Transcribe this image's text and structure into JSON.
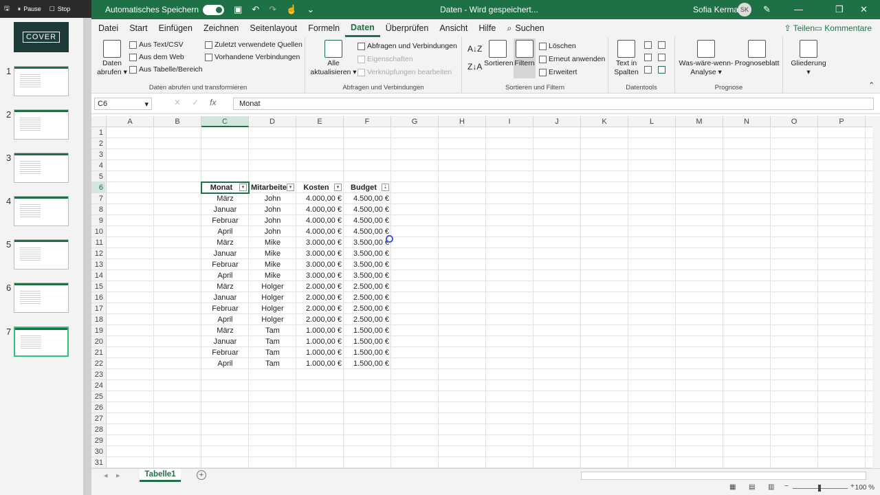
{
  "recorder": {
    "pause": "Pause",
    "stop": "Stop"
  },
  "slides": {
    "cover": "COVER",
    "numbers": [
      "1",
      "2",
      "3",
      "4",
      "5",
      "6",
      "7"
    ]
  },
  "title": {
    "autosave": "Automatisches Speichern",
    "document": "Daten  -  Wird gespeichert...",
    "user": "Sofia Kermas",
    "avatar": "SK"
  },
  "menu": {
    "items": [
      "Datei",
      "Start",
      "Einfügen",
      "Zeichnen",
      "Seitenlayout",
      "Formeln",
      "Daten",
      "Überprüfen",
      "Ansicht",
      "Hilfe"
    ],
    "active": "Daten",
    "search": "Suchen",
    "share": "Teilen",
    "comments": "Kommentare"
  },
  "ribbon": {
    "g1": {
      "big": "Daten abrufen",
      "small": [
        "Aus Text/CSV",
        "Aus dem Web",
        "Aus Tabelle/Bereich",
        "Zuletzt verwendete Quellen",
        "Vorhandene Verbindungen"
      ],
      "label": "Daten abrufen und transformieren"
    },
    "g2": {
      "big": "Alle aktualisieren",
      "small": [
        "Abfragen und Verbindungen",
        "Eigenschaften",
        "Verknüpfungen bearbeiten"
      ],
      "label": "Abfragen und Verbindungen"
    },
    "g3": {
      "sort": "Sortieren",
      "filter": "Filtern",
      "small": [
        "Löschen",
        "Erneut anwenden",
        "Erweitert"
      ],
      "label": "Sortieren und Filtern"
    },
    "g4": {
      "big": "Text in Spalten",
      "label": "Datentools"
    },
    "g5": {
      "whatif": "Was-wäre-wenn-Analyse",
      "forecast": "Prognoseblatt",
      "label": "Prognose"
    },
    "g6": {
      "outline": "Gliederung"
    }
  },
  "formulabar": {
    "namebox": "C6",
    "fx": "fx",
    "value": "Monat"
  },
  "columns": [
    "A",
    "B",
    "C",
    "D",
    "E",
    "F",
    "G",
    "H",
    "I",
    "J",
    "K",
    "L",
    "M",
    "N",
    "O",
    "P"
  ],
  "rows": [
    "1",
    "2",
    "3",
    "4",
    "5",
    "6",
    "7",
    "8",
    "9",
    "10",
    "11",
    "12",
    "13",
    "14",
    "15",
    "16",
    "17",
    "18",
    "19",
    "20",
    "21",
    "22",
    "23",
    "24",
    "25",
    "26",
    "27",
    "28",
    "29",
    "30",
    "31"
  ],
  "table": {
    "headers": [
      "Monat",
      "Mitarbeiter",
      "Kosten",
      "Budget"
    ],
    "rows": [
      [
        "März",
        "John",
        "4.000,00 €",
        "4.500,00 €"
      ],
      [
        "Januar",
        "John",
        "4.000,00 €",
        "4.500,00 €"
      ],
      [
        "Februar",
        "John",
        "4.000,00 €",
        "4.500,00 €"
      ],
      [
        "April",
        "John",
        "4.000,00 €",
        "4.500,00 €"
      ],
      [
        "März",
        "Mike",
        "3.000,00 €",
        "3.500,00 €"
      ],
      [
        "Januar",
        "Mike",
        "3.000,00 €",
        "3.500,00 €"
      ],
      [
        "Februar",
        "Mike",
        "3.000,00 €",
        "3.500,00 €"
      ],
      [
        "April",
        "Mike",
        "3.000,00 €",
        "3.500,00 €"
      ],
      [
        "März",
        "Holger",
        "2.000,00 €",
        "2.500,00 €"
      ],
      [
        "Januar",
        "Holger",
        "2.000,00 €",
        "2.500,00 €"
      ],
      [
        "Februar",
        "Holger",
        "2.000,00 €",
        "2.500,00 €"
      ],
      [
        "April",
        "Holger",
        "2.000,00 €",
        "2.500,00 €"
      ],
      [
        "März",
        "Tam",
        "1.000,00 €",
        "1.500,00 €"
      ],
      [
        "Januar",
        "Tam",
        "1.000,00 €",
        "1.500,00 €"
      ],
      [
        "Februar",
        "Tam",
        "1.000,00 €",
        "1.500,00 €"
      ],
      [
        "April",
        "Tam",
        "1.000,00 €",
        "1.500,00 €"
      ]
    ]
  },
  "sheet": {
    "tab": "Tabelle1",
    "add": "+"
  },
  "status": {
    "zoom": "100 %"
  },
  "colors": {
    "accent": "#1e7145"
  }
}
